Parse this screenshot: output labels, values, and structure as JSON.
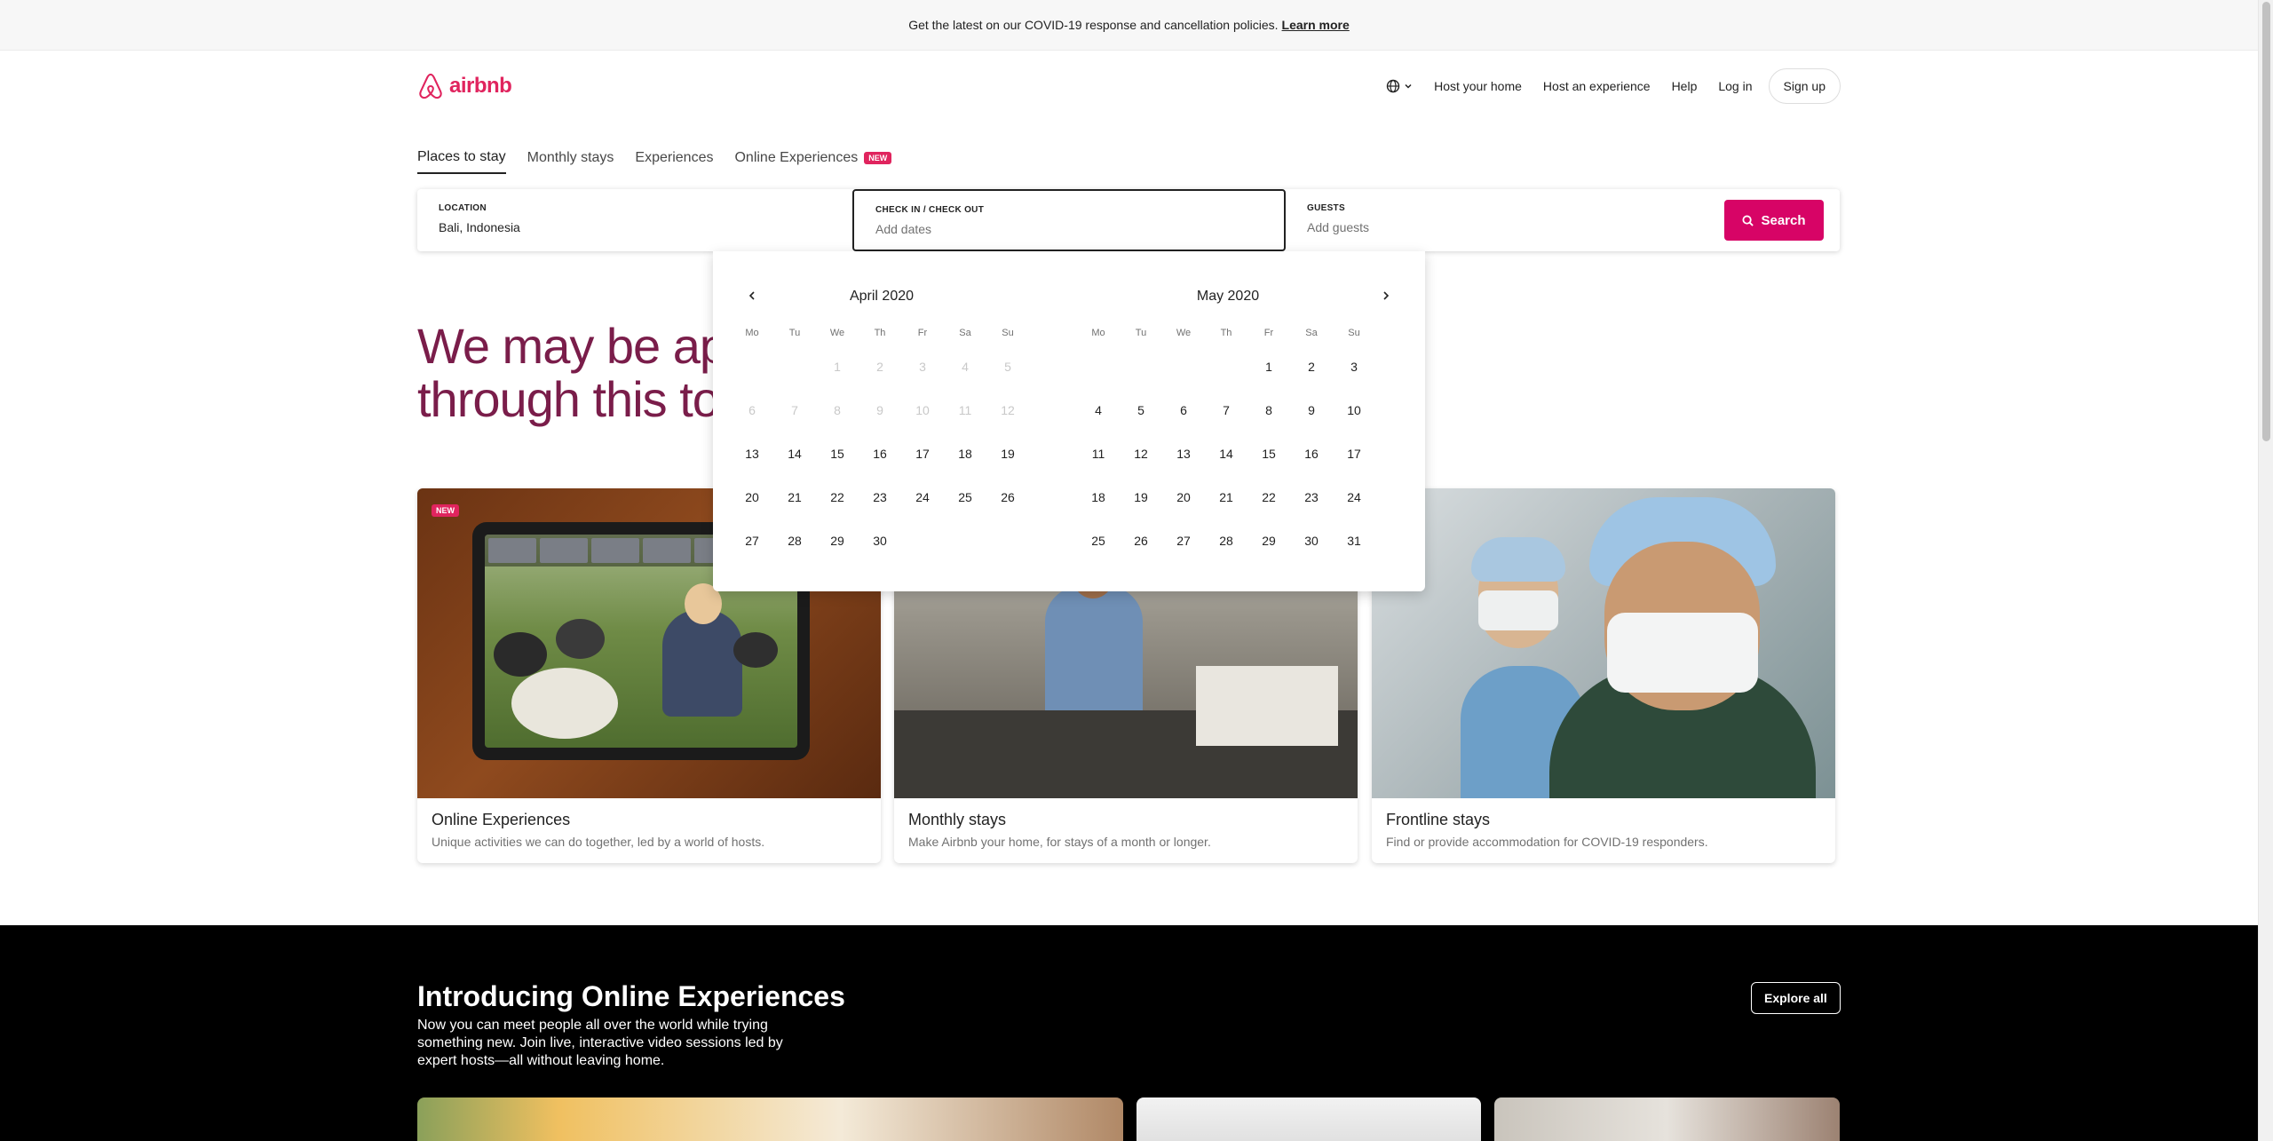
{
  "banner": {
    "text": "Get the latest on our COVID-19 response and cancellation policies.",
    "link": "Learn more"
  },
  "brand": {
    "name": "airbnb",
    "color": "#e0245e"
  },
  "topnav": {
    "globe_icon": "globe-icon",
    "items": [
      "Host your home",
      "Host an experience",
      "Help",
      "Log in"
    ],
    "signup": "Sign up"
  },
  "tabs": [
    {
      "label": "Places to stay",
      "active": true
    },
    {
      "label": "Monthly stays"
    },
    {
      "label": "Experiences"
    },
    {
      "label": "Online Experiences",
      "badge": "NEW"
    }
  ],
  "search": {
    "location_label": "LOCATION",
    "location_value": "Bali, Indonesia",
    "dates_label": "CHECK IN / CHECK OUT",
    "dates_placeholder": "Add dates",
    "guests_label": "GUESTS",
    "guests_placeholder": "Add guests",
    "button": "Search",
    "accent": "#d70466"
  },
  "hero": {
    "line1": "We may be apa",
    "line2": "through this tog"
  },
  "calendar": {
    "weekdays": [
      "Mo",
      "Tu",
      "We",
      "Th",
      "Fr",
      "Sa",
      "Su"
    ],
    "months": [
      {
        "title": "April 2020",
        "offset": 2,
        "days": 30,
        "disabled_until": 13
      },
      {
        "title": "May 2020",
        "offset": 4,
        "days": 31,
        "disabled_until": 0
      }
    ]
  },
  "cards": [
    {
      "title": "Online Experiences",
      "subtitle": "Unique activities we can do together, led by a world of hosts.",
      "badge": "NEW"
    },
    {
      "title": "Monthly stays",
      "subtitle": "Make Airbnb your home, for stays of a month or longer."
    },
    {
      "title": "Frontline stays",
      "subtitle": "Find or provide accommodation for COVID-19 responders."
    }
  ],
  "online": {
    "title": "Introducing Online Experiences",
    "body": "Now you can meet people all over the world while trying something new. Join live, interactive video sessions led by expert hosts—all without leaving home.",
    "button": "Explore all"
  }
}
